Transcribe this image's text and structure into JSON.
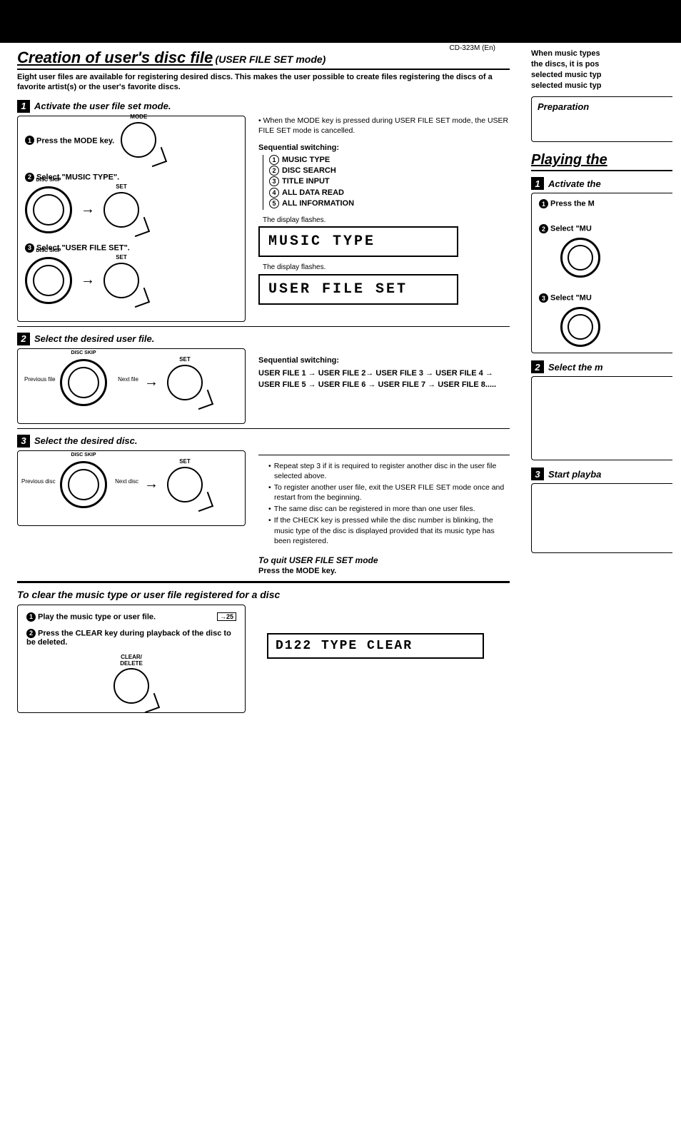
{
  "model": "CD-323M (En)",
  "main": {
    "title": "Creation of user's disc file",
    "title_mode": "(USER FILE SET mode)",
    "intro": "Eight user files are available for registering desired discs. This makes the user possible to create files registering the discs of a favorite artist(s) or the user's favorite discs.",
    "step1": {
      "num": "1",
      "label": "Activate the user file set mode.",
      "s1": "Press the MODE key.",
      "s1_key": "MODE",
      "s2": "Select \"MUSIC TYPE\".",
      "s3": "Select \"USER FILE SET\".",
      "dial_lbl": "DISC SKIP",
      "set_lbl": "SET",
      "note": "When the MODE key is pressed during USER FILE SET mode, the USER FILE SET mode is cancelled.",
      "seq_hd": "Sequential switching:",
      "seq": [
        "MUSIC TYPE",
        "DISC SEARCH",
        "TITLE INPUT",
        "ALL DATA READ",
        "ALL INFORMATION"
      ],
      "disp_note": "The display flashes.",
      "lcd1": "MUSIC TYPE",
      "lcd2": "USER FILE SET"
    },
    "step2": {
      "num": "2",
      "label": "Select the desired user file.",
      "prev": "Previous file",
      "next": "Next file",
      "seq_hd": "Sequential switching:",
      "seq_files": "USER FILE 1 → USER FILE 2→ USER FILE 3 → USER FILE 4 → USER FILE 5 → USER FILE 6 → USER FILE 7 → USER FILE 8....."
    },
    "step3": {
      "num": "3",
      "label": "Select the desired disc.",
      "prev": "Previous disc",
      "next": "Next disc",
      "notes": [
        "Repeat step 3 if it is required to register another disc in the user file selected above.",
        "To register another user file, exit the USER FILE SET mode once and restart from the beginning.",
        "The same disc can be registered in more than one user files.",
        "If the CHECK key is pressed while the disc number is blinking, the music type of the disc is displayed provided that its music type has been registered."
      ]
    },
    "quit": {
      "hd": "To quit USER FILE SET mode",
      "body": "Press the MODE key."
    },
    "clear": {
      "title": "To clear the music type or user file registered for a disc",
      "s1": "Play the music type or user file.",
      "page_ref": "25",
      "s2": "Press the CLEAR key during playback of the disc to be deleted.",
      "key_lbl": "CLEAR/\nDELETE",
      "lcd": "D122 TYPE CLEAR"
    }
  },
  "right": {
    "snip": "When music types\nthe discs, it is pos\nselected music typ\nselected music typ",
    "prep": "Preparation",
    "title": "Playing the",
    "step1": {
      "num": "1",
      "label": "Activate the",
      "s1": "Press the M",
      "s2": "Select \"MU",
      "s3": "Select \"MU"
    },
    "step2": {
      "num": "2",
      "label": "Select the m"
    },
    "step3": {
      "num": "3",
      "label": "Start playba"
    }
  }
}
